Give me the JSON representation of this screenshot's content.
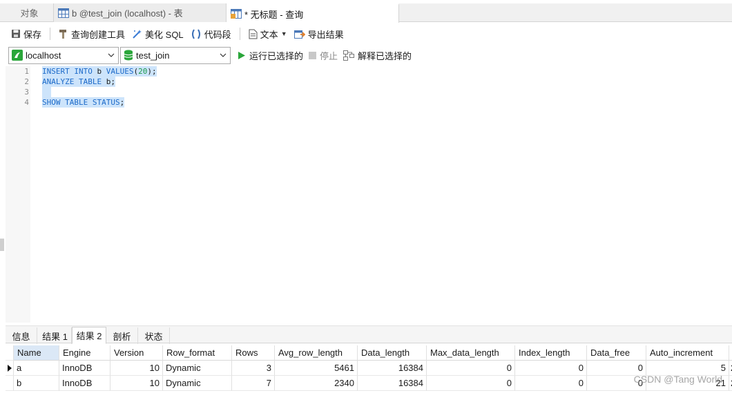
{
  "tabs": {
    "objects": "对象",
    "table_tab": "b @test_join (localhost) - 表",
    "query_tab": "* 无标题 - 查询"
  },
  "toolbar": {
    "save": "保存",
    "query_builder": "查询创建工具",
    "beautify": "美化 SQL",
    "snippet": "代码段",
    "text": "文本",
    "export": "导出结果"
  },
  "connection": {
    "server": "localhost",
    "database": "test_join",
    "run_selected": "运行已选择的",
    "stop": "停止",
    "explain_selected": "解释已选择的"
  },
  "editor": {
    "line_numbers": [
      "1",
      "2",
      "3",
      "4"
    ],
    "line1": {
      "kw1": "INSERT INTO",
      "id": " b ",
      "kw2": "VALUES",
      "open": "(",
      "num": "20",
      "close": ");"
    },
    "line2": {
      "kw": "ANALYZE TABLE",
      "rest": " b;"
    },
    "line4": {
      "kw": "SHOW TABLE STATUS",
      "rest": ";"
    }
  },
  "result_tabs": [
    "信息",
    "结果 1",
    "结果 2",
    "剖析",
    "状态"
  ],
  "grid": {
    "columns": [
      "Name",
      "Engine",
      "Version",
      "Row_format",
      "Rows",
      "Avg_row_length",
      "Data_length",
      "Max_data_length",
      "Index_length",
      "Data_free",
      "Auto_increment",
      "C"
    ],
    "rows": [
      [
        "a",
        "InnoDB",
        "10",
        "Dynamic",
        "3",
        "5461",
        "16384",
        "0",
        "0",
        "0",
        "5",
        "2"
      ],
      [
        "b",
        "InnoDB",
        "10",
        "Dynamic",
        "7",
        "2340",
        "16384",
        "0",
        "0",
        "0",
        "21",
        "2"
      ]
    ]
  },
  "watermark": "CSDN @Tang World",
  "colors": {
    "keyword": "#1c6ac9",
    "number": "#1c9a4a",
    "selection": "#cde4fb",
    "run_green": "#2aa63a"
  }
}
